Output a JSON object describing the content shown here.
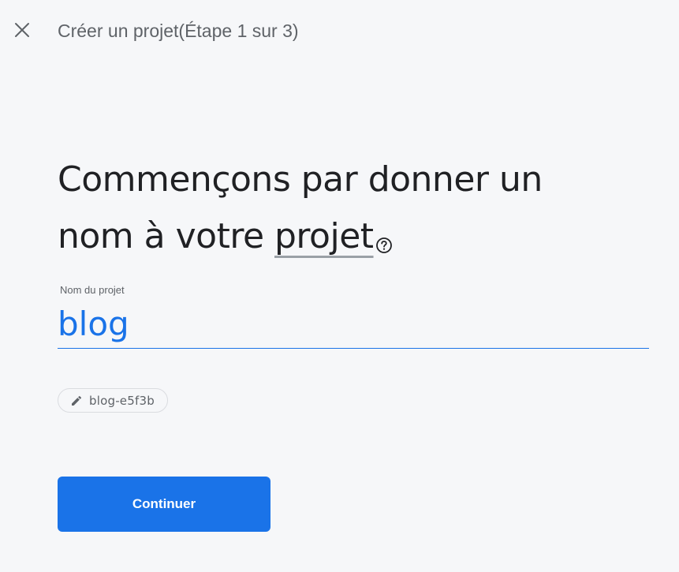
{
  "header": {
    "title": "Créer un projet(Étape 1 sur 3)",
    "close_icon": "close-icon"
  },
  "main": {
    "heading_line1": "Commençons par donner un",
    "heading_line2_prefix": "nom à votre ",
    "heading_line2_term": "projet",
    "help_icon": "help-circle-icon"
  },
  "project_name_field": {
    "label": "Nom du projet",
    "value": "blog"
  },
  "project_id_chip": {
    "icon": "pencil-icon",
    "value": "blog-e5f3b"
  },
  "actions": {
    "continue_label": "Continuer"
  },
  "colors": {
    "accent": "#1a73e8",
    "background": "#f6f7f9",
    "heading_text": "#202124",
    "secondary_text": "#5f6368"
  }
}
